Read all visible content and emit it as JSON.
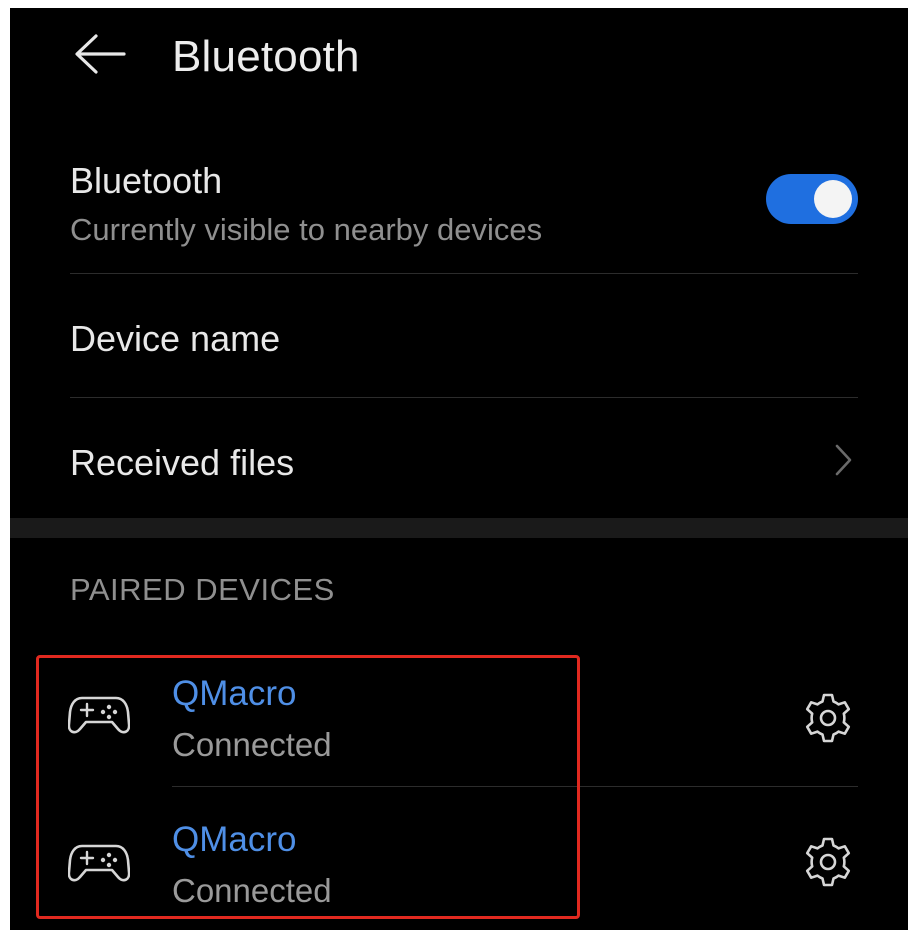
{
  "header": {
    "back_icon": "arrow-left-icon",
    "title": "Bluetooth"
  },
  "bluetooth_toggle": {
    "label": "Bluetooth",
    "subtitle": "Currently visible to nearby devices",
    "enabled": true,
    "accent_color": "#1f6fe0"
  },
  "device_name": {
    "label": "Device name"
  },
  "received_files": {
    "label": "Received files",
    "icon": "chevron-right-icon"
  },
  "paired_section": {
    "header": "PAIRED DEVICES",
    "devices": [
      {
        "name": "QMacro",
        "status": "Connected",
        "icon": "gamepad-icon",
        "settings_icon": "gear-icon"
      },
      {
        "name": "QMacro",
        "status": "Connected",
        "icon": "gamepad-icon",
        "settings_icon": "gear-icon"
      }
    ],
    "name_color": "#4f8fe6",
    "highlight_color": "#e0291f"
  }
}
